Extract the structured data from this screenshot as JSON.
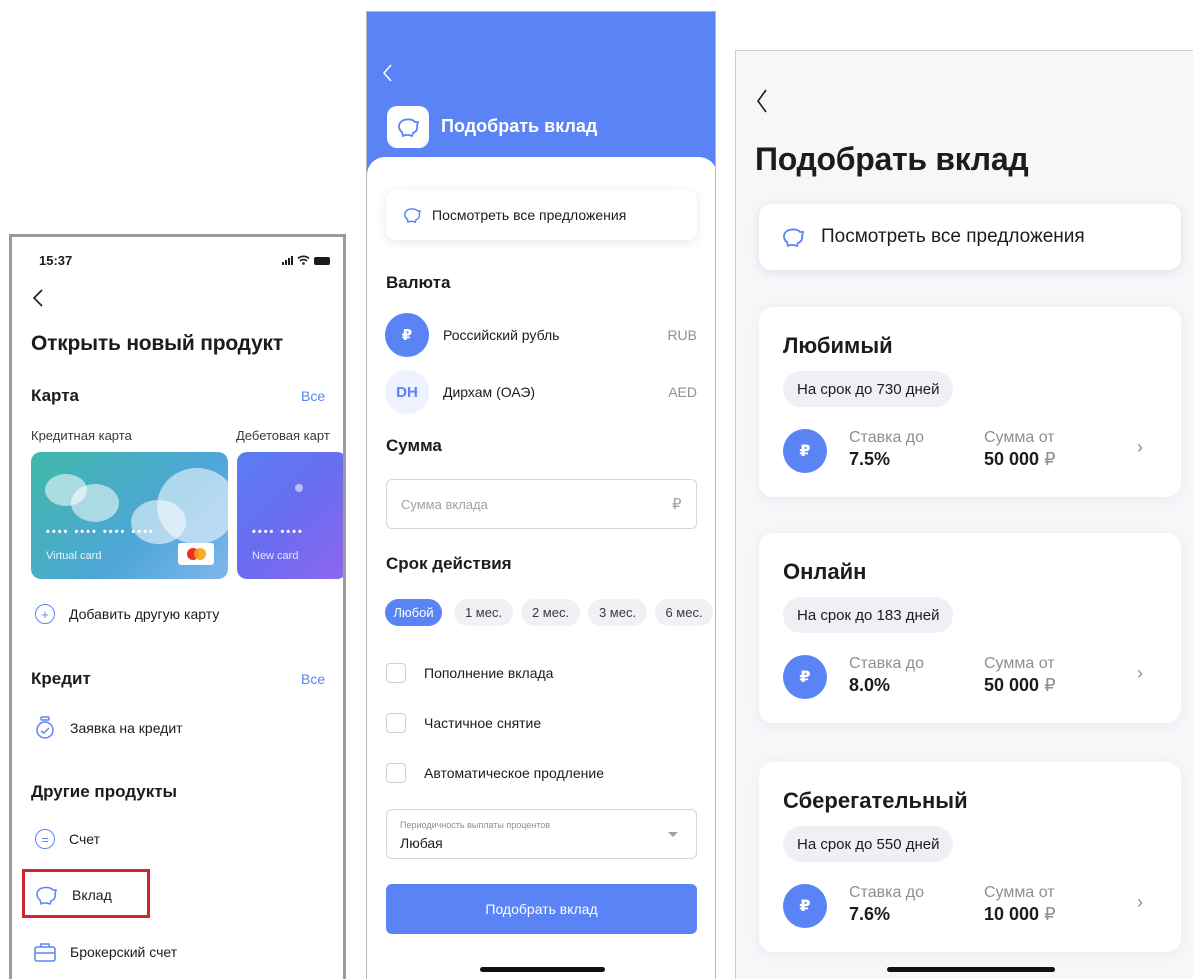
{
  "colors": {
    "accent": "#5a84f5",
    "highlight": "#d0252b"
  },
  "screen1": {
    "status_time": "15:37",
    "title": "Открыть новый продукт",
    "card_section": {
      "header": "Карта",
      "all_link": "Все",
      "credit_label": "Кредитная карта",
      "debit_label": "Дебетовая карт",
      "credit_dots": "•••• •••• •••• ••••",
      "credit_name": "Virtual card",
      "debit_dots": "•••• ••••",
      "debit_name": "New card",
      "add_card": "Добавить другую карту"
    },
    "credit_section": {
      "header": "Кредит",
      "all_link": "Все",
      "apply": "Заявка на кредит"
    },
    "other_section": {
      "header": "Другие продукты",
      "items": [
        "Счет",
        "Вклад",
        "Брокерский счет"
      ]
    }
  },
  "screen2": {
    "header_title": "Подобрать вклад",
    "view_all": "Посмотреть все предложения",
    "currency_label": "Валюта",
    "currencies": [
      {
        "icon": "₽",
        "name": "Российский рубль",
        "code": "RUB"
      },
      {
        "icon": "DH",
        "name": "Дирхам (ОАЭ)",
        "code": "AED"
      }
    ],
    "amount_label": "Сумма",
    "amount_placeholder": "Сумма вклада",
    "amount_suffix": "₽",
    "term_label": "Срок действия",
    "term_chips": [
      "Любой",
      "1 мес.",
      "2 мес.",
      "3 мес.",
      "6 мес."
    ],
    "checkboxes": [
      "Пополнение вклада",
      "Частичное снятие",
      "Автоматическое продление"
    ],
    "payout_label": "Периодичность выплаты процентов",
    "payout_value": "Любая",
    "submit": "Подобрать вклад"
  },
  "screen3": {
    "title": "Подобрать вклад",
    "view_all": "Посмотреть все предложения",
    "offers": [
      {
        "name": "Любимый",
        "term": "На срок до 730 дней",
        "rate_label": "Ставка до",
        "rate": "7.5%",
        "sum_label": "Сумма от",
        "sum": "50 000",
        "currency": "₽",
        "icon": "₽"
      },
      {
        "name": "Онлайн",
        "term": "На срок до 183 дней",
        "rate_label": "Ставка до",
        "rate": "8.0%",
        "sum_label": "Сумма от",
        "sum": "50 000",
        "currency": "₽",
        "icon": "₽"
      },
      {
        "name": "Сберегательный",
        "term": "На срок до 550 дней",
        "rate_label": "Ставка до",
        "rate": "7.6%",
        "sum_label": "Сумма от",
        "sum": "10 000",
        "currency": "₽",
        "icon": "₽"
      }
    ]
  }
}
